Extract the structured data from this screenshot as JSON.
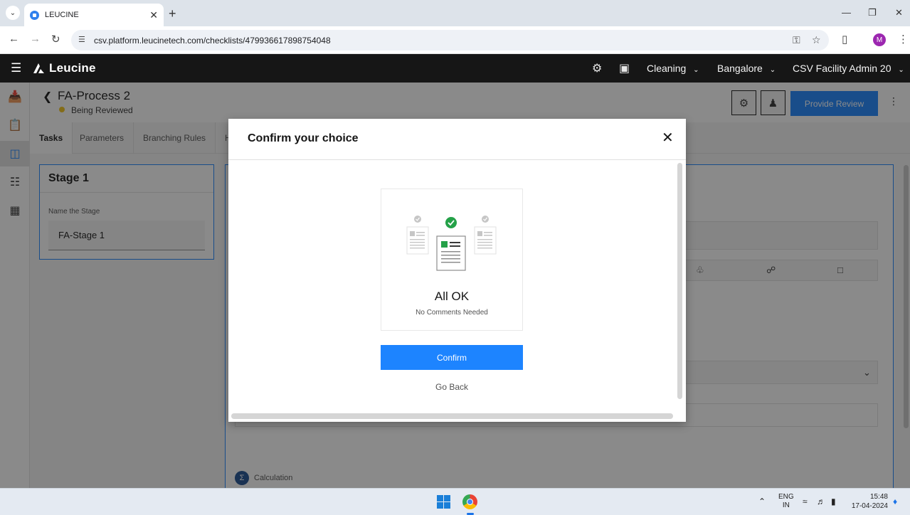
{
  "browser": {
    "tab_title": "LEUCINE",
    "url": "csv.platform.leucinetech.com/checklists/479936617898754048",
    "profile_initial": "M"
  },
  "header": {
    "logo_text": "Leucine",
    "selects": [
      {
        "label": "Cleaning"
      },
      {
        "label": "Bangalore"
      },
      {
        "label": "CSV Facility Admin 20"
      }
    ]
  },
  "page": {
    "title": "FA-Process 2",
    "status": "Being Reviewed",
    "status_color": "#f1c21b",
    "provide_review_label": "Provide Review",
    "tabs": [
      {
        "label": "Tasks",
        "active": true
      },
      {
        "label": "Parameters"
      },
      {
        "label": "Branching Rules"
      },
      {
        "label": "H"
      }
    ]
  },
  "stage": {
    "title": "Stage 1",
    "name_label": "Name the Stage",
    "name_value": "FA-Stage 1"
  },
  "task_panel": {
    "calculation_label": "Calculation"
  },
  "modal": {
    "title": "Confirm your choice",
    "ok_title": "All OK",
    "ok_subtitle": "No Comments Needed",
    "confirm_label": "Confirm",
    "go_back_label": "Go Back"
  },
  "taskbar": {
    "lang_line1": "ENG",
    "lang_line2": "IN",
    "time": "15:48",
    "date": "17-04-2024"
  },
  "colors": {
    "primary": "#1d84ff",
    "header_bg": "#161616",
    "success": "#24a148"
  }
}
